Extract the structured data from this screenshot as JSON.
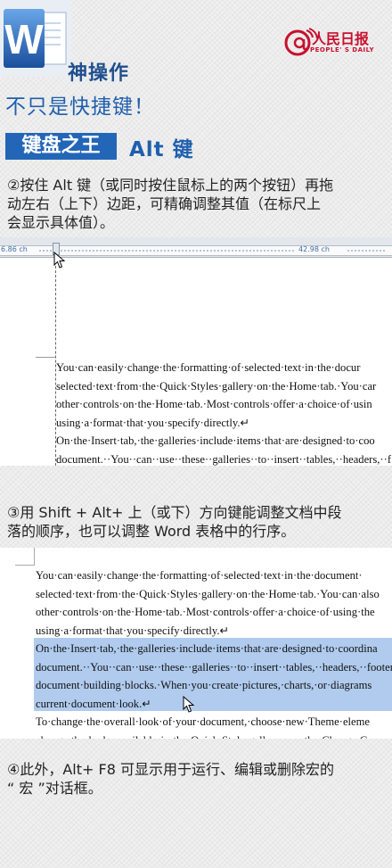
{
  "header": {
    "logo_letter": "W",
    "title_line1": "神操作",
    "title_line2": "不只是快捷键！",
    "brand_name": "人民日报",
    "brand_sub": "PEOPLE' S DAILY",
    "brand_at": "@"
  },
  "section": {
    "label": "键盘之王",
    "key": "Alt 键"
  },
  "instructions": {
    "step2": [
      "②按住 Alt 键（或同时按住鼠标上的两个按钮）再拖",
      "动左右（上下）边距，可精确调整其值（在标尺上",
      "会显示具体值）。"
    ],
    "step3": [
      "③用 Shift + Alt+ 上（或下）方向键能调整文档中段",
      "落的顺序，也可以调整 Word 表格中的行序。"
    ],
    "step4": [
      "④此外，Alt+ F8 可显示用于运行、编辑或删除宏的",
      "“ 宏 ”对话框。"
    ]
  },
  "screenshot1": {
    "ruler_left": "6.86 ch",
    "ruler_right": "42.98 ch",
    "lines": [
      "You·can·easily·change·the·formatting·of·selected·text·in·the·docur",
      "selected·text·from·the·Quick·Styles·gallery·on·the·Home·tab.·You·car",
      "other·controls·on·the·Home·tab.·Most·controls·offer·a·choice·of·usin",
      "using·a·format·that·you·specify·directly.↵",
      "On·the·Insert·tab,·the·galleries·include·items·that·are·designed·to·coo",
      "document.··You··can··use··these··galleries··to··insert··tables,··headers,··f"
    ]
  },
  "screenshot2": {
    "lines": [
      "You·can·easily·change·the·formatting·of·selected·text·in·the·document·",
      "selected·text·from·the·Quick·Styles·gallery·on·the·Home·tab.·You·can·also",
      "other·controls·on·the·Home·tab.·Most·controls·offer·a·choice·of·using·the",
      "using·a·format·that·you·specify·directly.↵",
      "On·the·Insert·tab,·the·galleries·include·items·that·are·designed·to·coordina",
      "document.··You··can··use··these··galleries··to··insert··tables,··headers,··footer",
      "document·building·blocks.·When·you·create·pictures,·charts,·or·diagrams",
      "current·document·look.↵",
      "To·change·the·overall·look·of·your·document,·choose·new·Theme·eleme",
      "change·the·looks·available·in·the·Quick·Style·gallery,·use·the·Change·Cu"
    ]
  },
  "colors": {
    "accent_blue": "#2366b8",
    "brand_red": "#c8102e",
    "selection": "#b0cbee"
  }
}
